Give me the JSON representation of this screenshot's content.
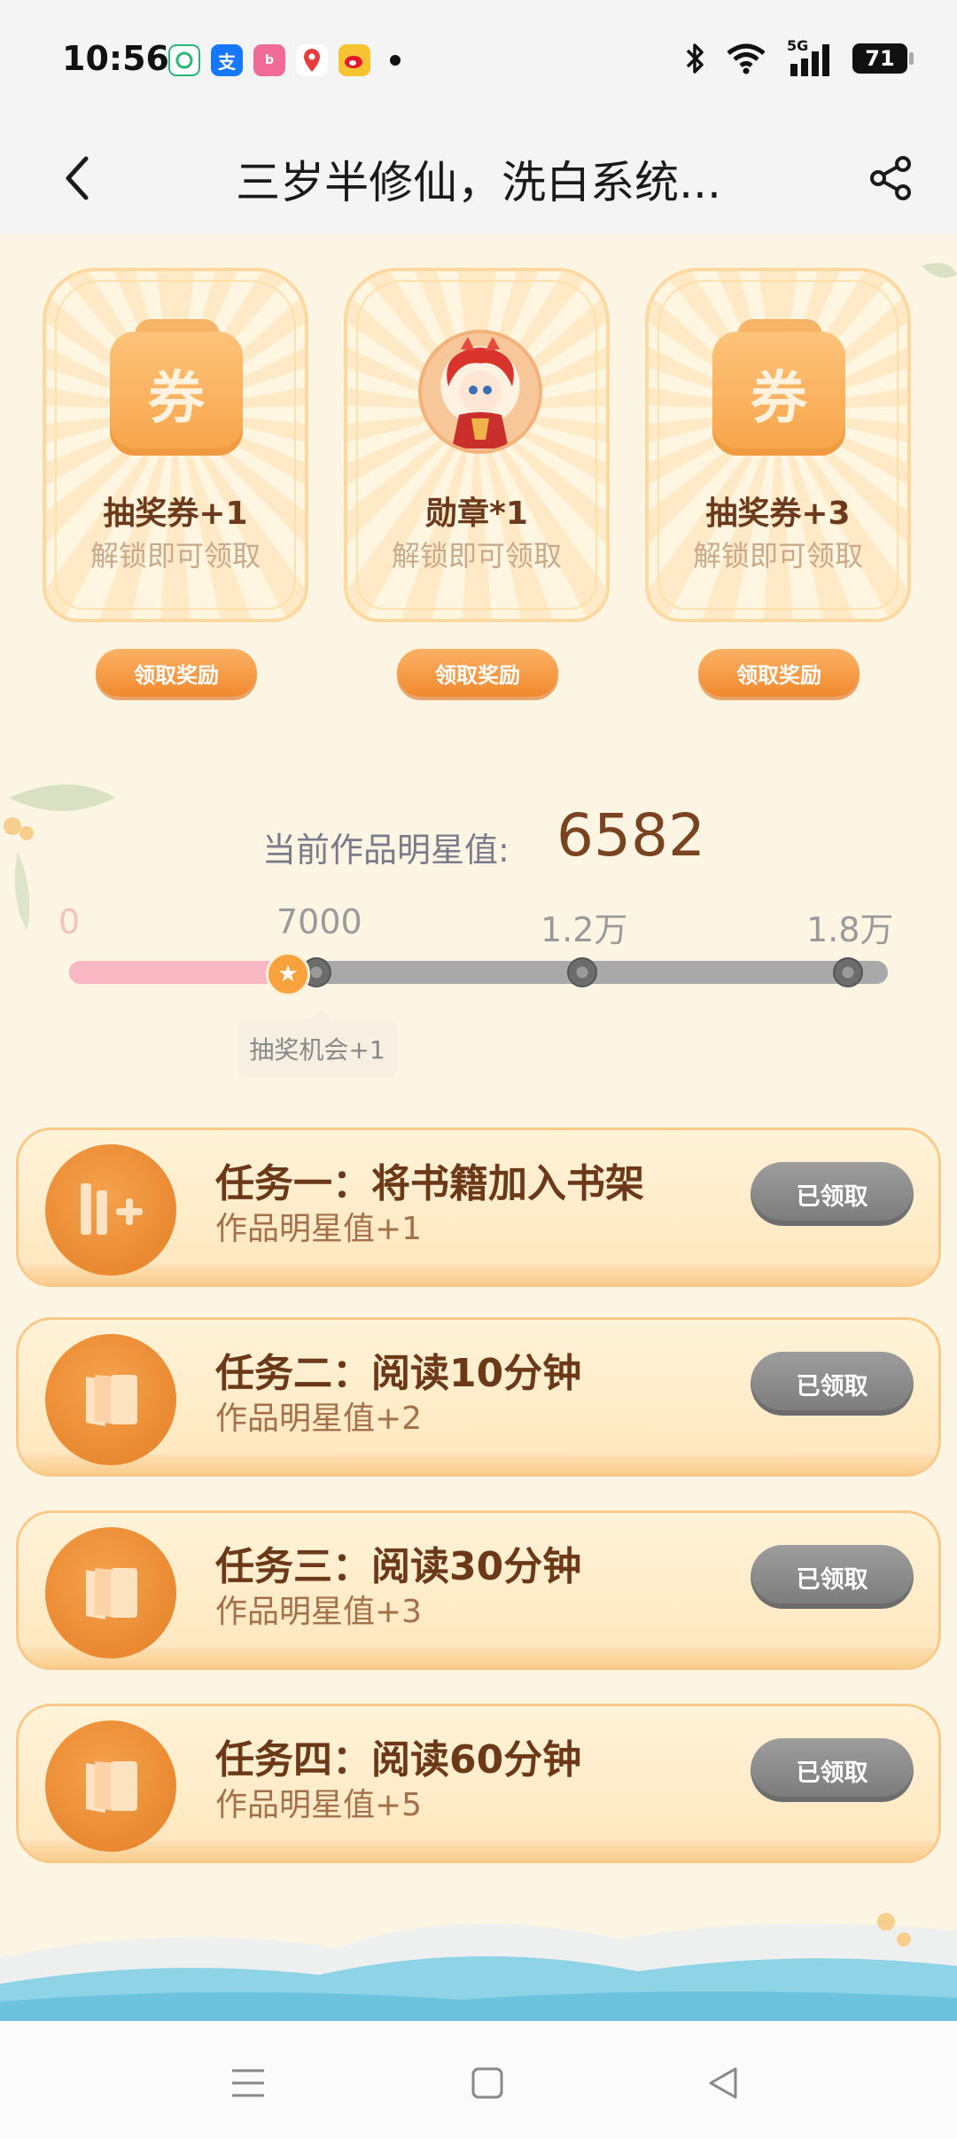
{
  "status_bar": {
    "time": "10:56",
    "network": "5G",
    "battery": "71",
    "apps": [
      {
        "icon": "green-app-icon",
        "label": "",
        "color": "#2bb673"
      },
      {
        "icon": "alipay-icon",
        "label": "支",
        "color": "#1677ff"
      },
      {
        "icon": "bilibili-icon",
        "label": "b",
        "color": "#f06b97"
      },
      {
        "icon": "map-pin-app-icon",
        "label": "",
        "color": "#e83b3b"
      },
      {
        "icon": "weibo-icon",
        "label": "",
        "color": "#f7c331"
      }
    ]
  },
  "header": {
    "title": "三岁半修仙，洗白系统..."
  },
  "rewards": [
    {
      "icon": "ticket-icon",
      "icon_text": "券",
      "title": "抽奖券+1",
      "subtitle": "解锁即可领取",
      "button": "领取奖励"
    },
    {
      "icon": "medal-character-icon",
      "icon_text": "",
      "title": "勋章*1",
      "subtitle": "解锁即可领取",
      "button": "领取奖励"
    },
    {
      "icon": "ticket-icon",
      "icon_text": "券",
      "title": "抽奖券+3",
      "subtitle": "解锁即可领取",
      "button": "领取奖励"
    }
  ],
  "star": {
    "label": "当前作品明星值:",
    "value": "6582"
  },
  "progress": {
    "start_label": "0",
    "milestones": [
      "7000",
      "1.2万",
      "1.8万"
    ],
    "current": 6582,
    "max": 18000,
    "tooltip": "抽奖机会+1"
  },
  "tasks": [
    {
      "icon": "bookshelf-add-icon",
      "title": "任务一：将书籍加入书架",
      "reward": "作品明星值+1",
      "button": "已领取"
    },
    {
      "icon": "book-open-icon",
      "title": "任务二：阅读10分钟",
      "reward": "作品明星值+2",
      "button": "已领取"
    },
    {
      "icon": "book-open-icon",
      "title": "任务三：阅读30分钟",
      "reward": "作品明星值+3",
      "button": "已领取"
    },
    {
      "icon": "book-open-icon",
      "title": "任务四：阅读60分钟",
      "reward": "作品明星值+5",
      "button": "已领取"
    }
  ],
  "nav": [
    "menu-icon",
    "home-square-icon",
    "back-triangle-icon"
  ],
  "colors": {
    "accent_orange": "#f1892e",
    "title_brown": "#6b3818",
    "progress_fill": "#f9b7c4",
    "progress_track": "#a9a9a9",
    "claimed_gray": "#8a8a8a"
  }
}
